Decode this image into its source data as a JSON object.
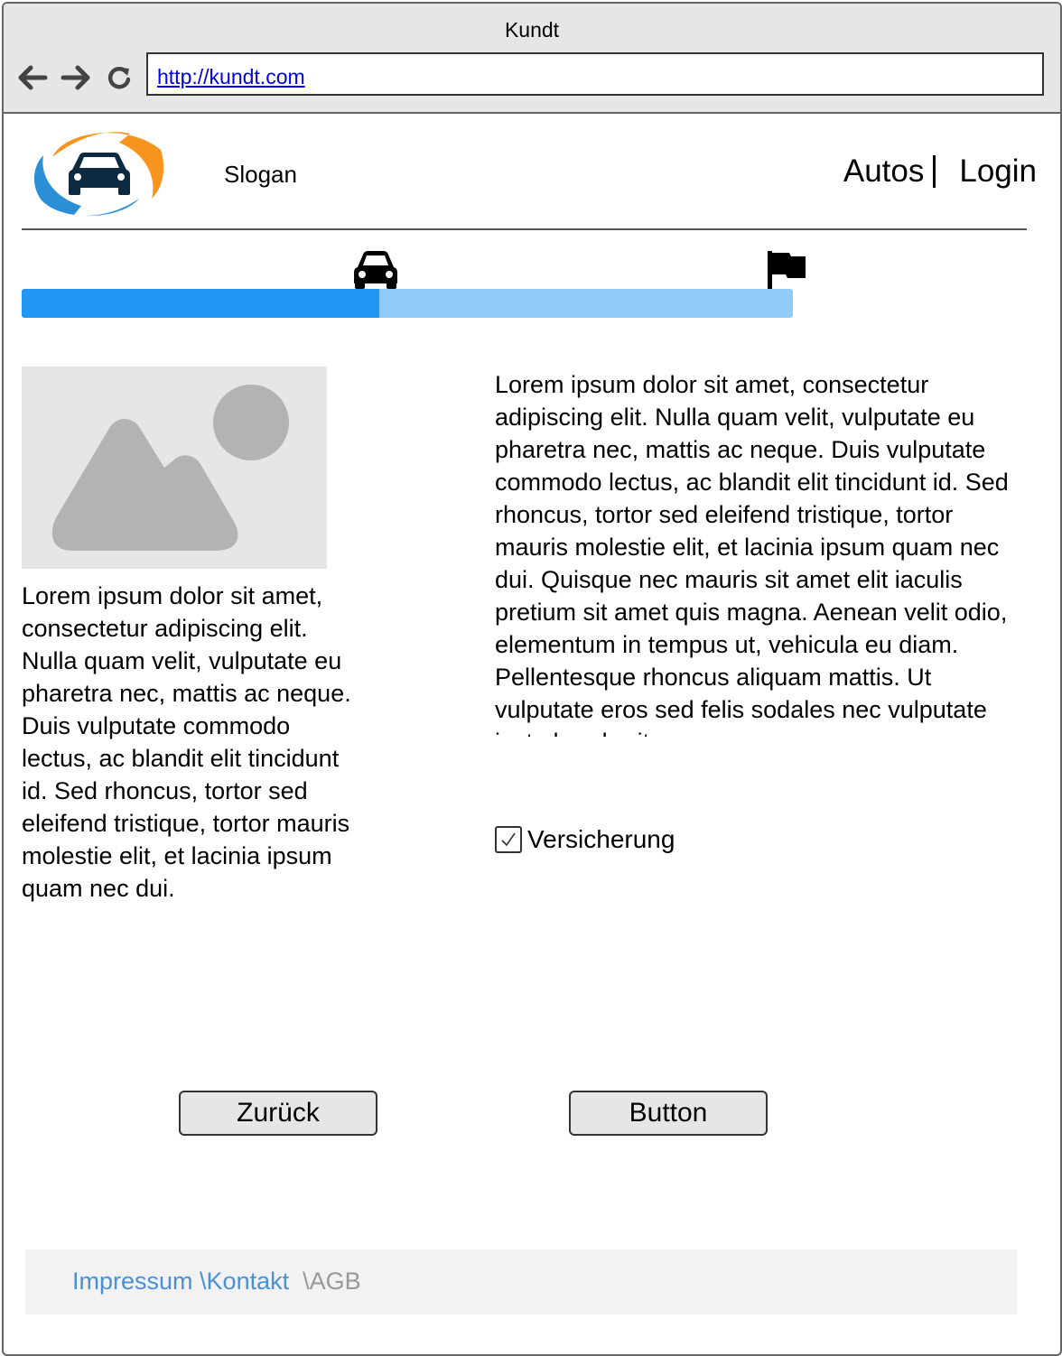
{
  "window": {
    "title": "Kundt"
  },
  "browser": {
    "url": "http://kundt.com"
  },
  "header": {
    "slogan": "Slogan",
    "nav": {
      "autos": "Autos",
      "login": "Login"
    }
  },
  "progress": {
    "value": 0.464
  },
  "left": {
    "text": "Lorem ipsum dolor sit amet, consectetur adipiscing elit. Nulla quam velit, vulputate eu pharetra nec, mattis ac neque. Duis vulputate commodo lectus, ac blandit elit tincidunt id. Sed rhoncus, tortor sed eleifend tristique, tortor mauris molestie elit, et lacinia ipsum quam nec dui."
  },
  "right": {
    "text": "Lorem ipsum dolor sit amet, consectetur adipiscing elit. Nulla quam velit, vulputate eu pharetra nec, mattis ac neque. Duis vulputate commodo lectus, ac blandit elit tincidunt id. Sed rhoncus, tortor sed eleifend tristique, tortor mauris molestie elit, et lacinia ipsum quam nec dui. Quisque nec mauris sit amet elit iaculis pretium sit amet quis magna. Aenean velit odio, elementum in tempus ut, vehicula eu diam. Pellentesque rhoncus aliquam mattis. Ut vulputate eros sed felis sodales nec vulputate justo hendrerit."
  },
  "checkbox": {
    "label": "Versicherung",
    "checked": true
  },
  "buttons": {
    "back": "Zurück",
    "next": "Button"
  },
  "footer": {
    "impressum": "Impressum",
    "kontakt": "\\Kontakt",
    "agb": "\\AGB"
  },
  "colors": {
    "progress_fill": "#2196f3",
    "progress_track": "#90caf9",
    "logo_orange": "#f7941d",
    "logo_blue": "#2a8fd4",
    "footer_link": "#4a90d9"
  },
  "icons": [
    "back-arrow-icon",
    "forward-arrow-icon",
    "reload-icon",
    "logo-car-icon",
    "car-icon",
    "flag-icon",
    "image-placeholder-icon",
    "check-icon"
  ]
}
